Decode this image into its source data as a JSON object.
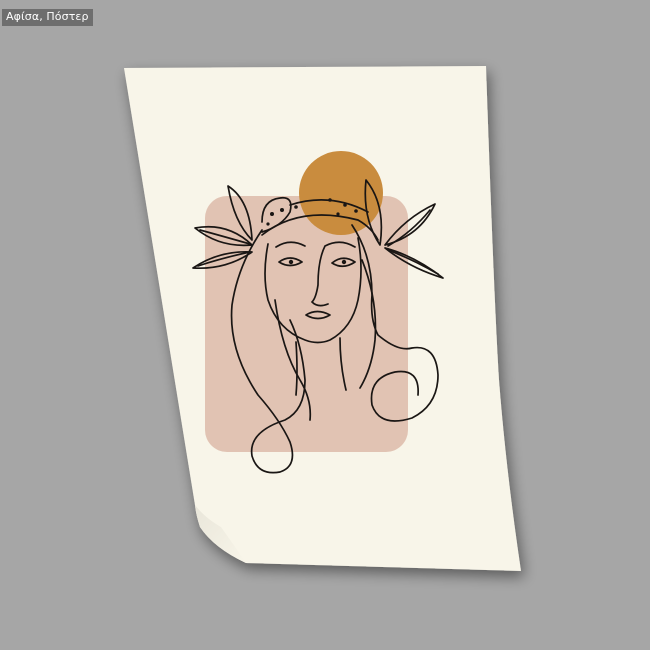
{
  "product_tag": {
    "label": "Αφίσα, Πόστερ"
  },
  "colors": {
    "background": "#a6a6a6",
    "paper": "#f8f5e9",
    "blush_block": "#e1c3b3",
    "sun_circle": "#c98c3e",
    "line_art": "#1a1614"
  }
}
